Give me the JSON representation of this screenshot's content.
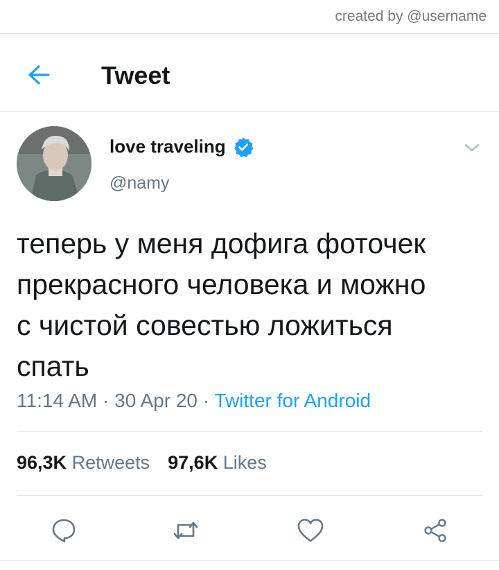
{
  "credit": "created by @username",
  "header": {
    "title": "Tweet",
    "back_icon": "arrow-left-icon",
    "accent": "#1da1f2"
  },
  "tweet": {
    "author": {
      "display_name": "love traveling",
      "handle": "@namy",
      "verified_icon": "verified-badge-icon"
    },
    "lines": [
      "теперь у меня дофига фоточек",
      "прекрасного человека и можно",
      "с чистой совестью ложиться",
      "спать"
    ],
    "time": "11:14 AM",
    "date": "30 Apr 20",
    "separator": "·",
    "source": "Twitter for Android"
  },
  "stats": {
    "retweets_count": "96,3K",
    "retweets_label": "Retweets",
    "likes_count": "97,6K",
    "likes_label": "Likes"
  },
  "actions": [
    "reply-icon",
    "retweet-icon",
    "like-icon",
    "share-icon"
  ],
  "colors": {
    "text": "#14171a",
    "secondary": "#657786",
    "divider": "#e1e8ed",
    "link": "#1da1f2"
  }
}
